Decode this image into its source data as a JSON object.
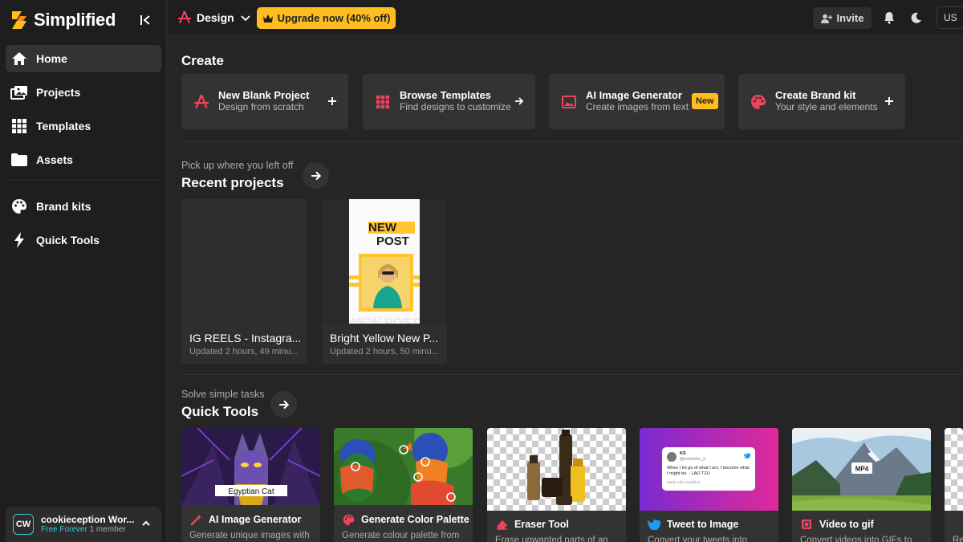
{
  "brand": {
    "name": "Simplified"
  },
  "sidebar": {
    "items": [
      {
        "label": "Home",
        "icon": "home-icon"
      },
      {
        "label": "Projects",
        "icon": "projects-icon"
      },
      {
        "label": "Templates",
        "icon": "grid-icon"
      },
      {
        "label": "Assets",
        "icon": "folder-icon"
      },
      {
        "label": "Brand kits",
        "icon": "palette-icon"
      },
      {
        "label": "Quick Tools",
        "icon": "bolt-icon"
      }
    ],
    "active": "Home",
    "workspace": {
      "initials": "CW",
      "name": "cookieception Wor...",
      "plan": "Free Forever",
      "members": "1 member"
    }
  },
  "header": {
    "mode": "Design",
    "upgrade_label": "Upgrade now (40% off)",
    "invite_label": "Invite",
    "language": "US"
  },
  "create": {
    "title": "Create",
    "cards": [
      {
        "title": "New Blank Project",
        "subtitle": "Design from scratch",
        "action": "+"
      },
      {
        "title": "Browse Templates",
        "subtitle": "Find designs to customize",
        "action": "→"
      },
      {
        "title": "AI Image Generator",
        "subtitle": "Create images from text",
        "badge": "New"
      },
      {
        "title": "Create Brand kit",
        "subtitle": "Your style and elements",
        "action": "+"
      }
    ]
  },
  "recent": {
    "subtitle": "Pick up where you left off",
    "title": "Recent projects",
    "projects": [
      {
        "title": "IG REELS - Instagra...",
        "updated": "Updated 2 hours, 49 minu..."
      },
      {
        "title": "Bright Yellow New P...",
        "updated": "Updated 2 hours, 50 minu...",
        "thumb_text": [
          "NEW",
          "POST",
          "NEW POST"
        ]
      }
    ]
  },
  "tools": {
    "subtitle": "Solve simple tasks",
    "title": "Quick Tools",
    "cards": [
      {
        "title": "AI Image Generator",
        "desc": "Generate unique images with",
        "caption": "Egyptian Cat"
      },
      {
        "title": "Generate Color Palette",
        "desc": "Generate colour palette from"
      },
      {
        "title": "Eraser Tool",
        "desc": "Erase unwanted parts of an"
      },
      {
        "title": "Tweet to Image",
        "desc": "Convert your tweets into",
        "tweet": {
          "name": "KS",
          "handle": "@kswilsho_0",
          "text": "When I let go of what I am, I become what I might be. - LAO TZU",
          "footer": "Made with Simplified"
        }
      },
      {
        "title": "Video to gif",
        "desc": "Convert videos into GIFs to",
        "badge": "MP4"
      },
      {
        "title": "",
        "desc": "Re"
      }
    ]
  },
  "colors": {
    "accent_yellow": "#ffbd1f",
    "accent_red": "#f0435a",
    "accent_teal": "#3bc8d8",
    "twitter_blue": "#1d9bf0"
  }
}
